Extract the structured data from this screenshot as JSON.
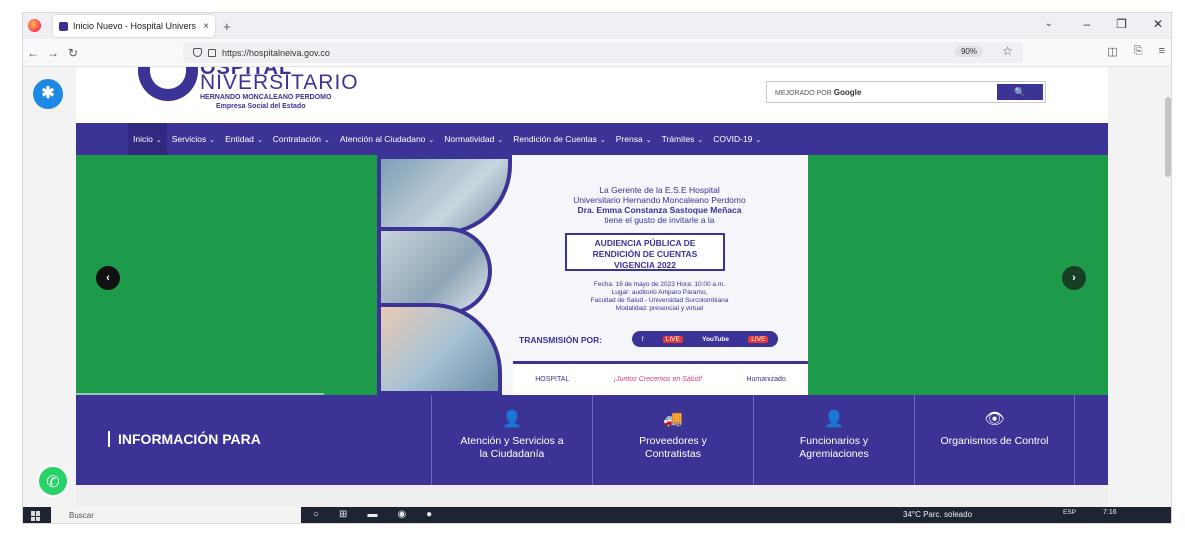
{
  "browser": {
    "tab_title": "Inicio Nuevo - Hospital Univers",
    "tab_close": "×",
    "new_tab": "+",
    "url": "https://hospitalneiva.gov.co",
    "zoom": "90%",
    "window_controls": [
      "⌄",
      "–",
      "❐",
      "✕"
    ]
  },
  "header": {
    "logo_top": "OSPITAL",
    "logo_main": "NIVERSITARIO",
    "logo_sub1": "HERNANDO MONCALEANO PERDOMO",
    "logo_sub2": "Empresa Social del Estado",
    "search_prefix": "MEJORADO POR",
    "search_brand": "Google",
    "search_button": "🔍"
  },
  "menu": [
    {
      "label": "Inicio"
    },
    {
      "label": "Servicios"
    },
    {
      "label": "Entidad"
    },
    {
      "label": "Contratación"
    },
    {
      "label": "Atención al Ciudadano"
    },
    {
      "label": "Normatividad"
    },
    {
      "label": "Rendición de Cuentas"
    },
    {
      "label": "Prensa"
    },
    {
      "label": "Trámites"
    },
    {
      "label": "COVID-19"
    }
  ],
  "banner": {
    "line1": "La Gerente de la E.S.E Hospital",
    "line2": "Universitario Hernando Moncaleano Perdomo",
    "line3": "Dra. Emma Constanza Sastoque Meñaca",
    "line4": "tiene el gusto de invitarle a la",
    "box_line1": "AUDIENCIA PÚBLICA DE",
    "box_line2": "RENDICIÓN DE CUENTAS",
    "box_line3": "VIGENCIA 2022",
    "detail1": "Fecha: 16 de mayo de 2023   Hora: 10:00 a.m.",
    "detail2": "Lugar: auditorio Amparo Páramo,",
    "detail3": "Facultad de Salud - Universidad Surcolombiana",
    "detail4": "Modalidad: presencial y virtual",
    "transmision": "TRANSMISIÓN POR:",
    "fb": "f",
    "live1": "LIVE",
    "yt": "YouTube",
    "live2": "LIVE",
    "footer_logo": "HOSPITAL",
    "footer_slogan": "¡Juntos Crecemos en Salud!",
    "footer_humanizado": "Humanizado"
  },
  "slider": {
    "prev": "‹",
    "next": "›"
  },
  "info": {
    "title": "INFORMACIÓN PARA",
    "cards": [
      {
        "line1": "Atención y Servicios a",
        "line2": "la Ciudadanía",
        "icon": "👤"
      },
      {
        "line1": "Proveedores y",
        "line2": "Contratistas",
        "icon": "🚚"
      },
      {
        "line1": "Funcionarios y",
        "line2": "Agremiaciones",
        "icon": "👤"
      },
      {
        "line1": "Organismos de Control",
        "line2": "",
        "icon": "👁"
      }
    ]
  },
  "widgets": {
    "accessibility": "✱",
    "whatsapp": "✆"
  },
  "taskbar": {
    "search": "Buscar",
    "weather": "34°C  Parc. soleado",
    "lang": "ESP",
    "time": "7:16"
  }
}
